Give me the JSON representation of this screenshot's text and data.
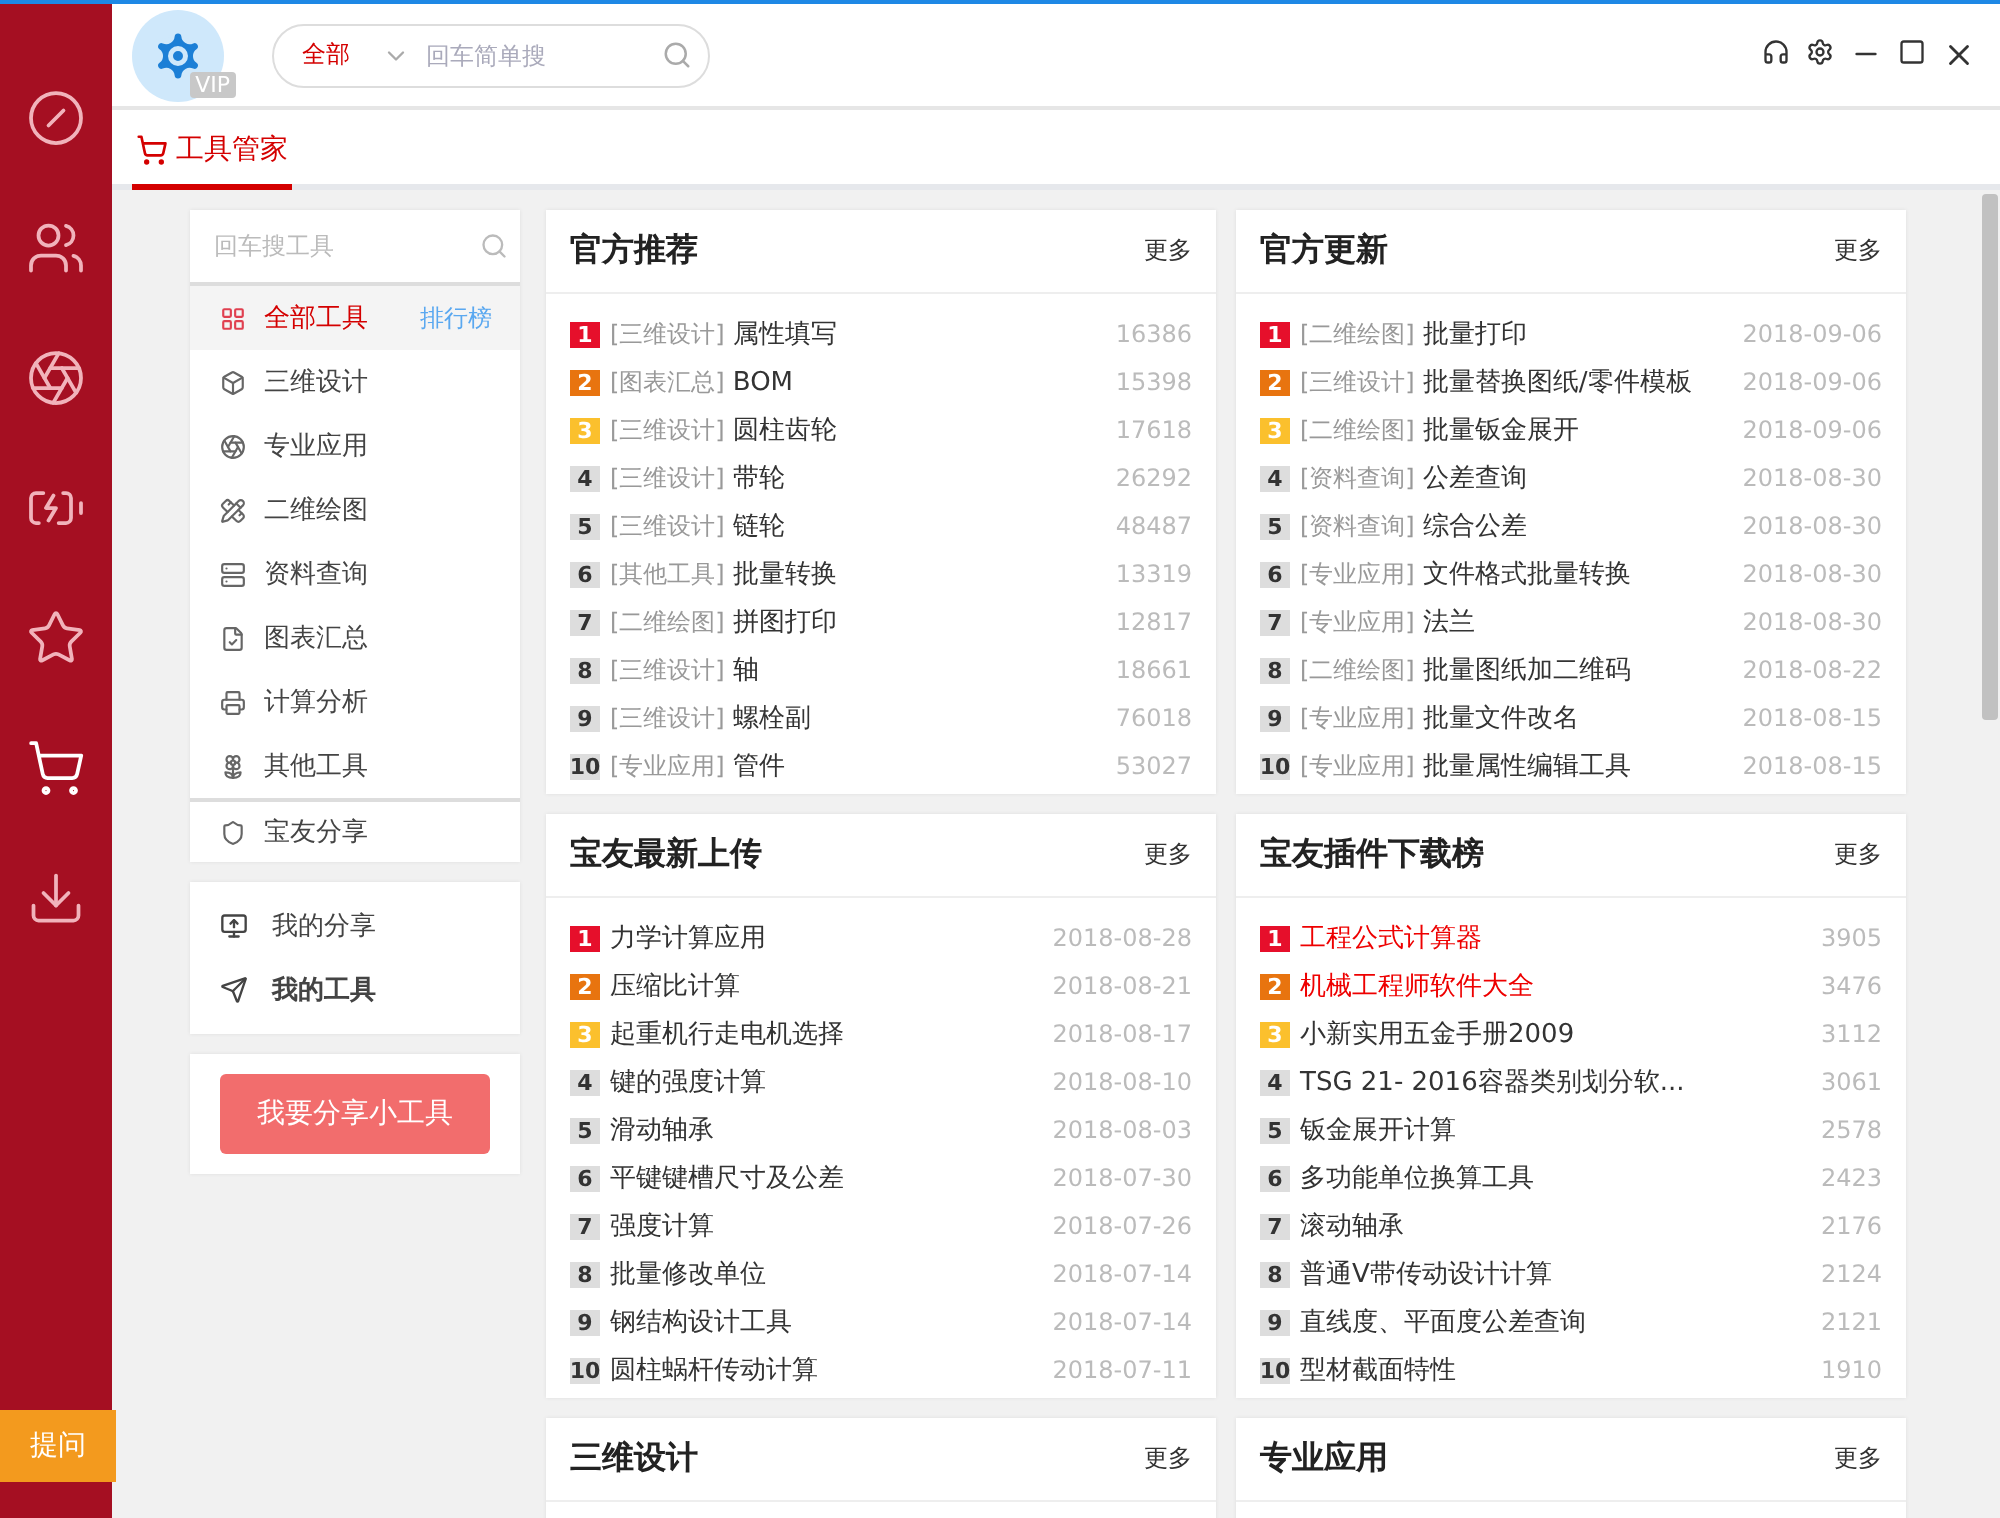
{
  "rail": {
    "items": [
      {
        "selected": false
      },
      {
        "selected": false
      },
      {
        "selected": false
      },
      {
        "selected": false
      },
      {
        "selected": false
      },
      {
        "selected": true
      },
      {
        "selected": false
      }
    ],
    "ask_button": "提问"
  },
  "header": {
    "vip_badge": "VIP",
    "search": {
      "scope": "全部",
      "placeholder": "回车简单搜"
    }
  },
  "tabs": [
    {
      "label": "工具管家",
      "selected": true
    }
  ],
  "sidebar": {
    "search": {
      "placeholder": "回车搜工具"
    },
    "categories": [
      {
        "label": "全部工具",
        "selected": true,
        "extra": "排行榜"
      },
      {
        "label": "三维设计",
        "selected": false
      },
      {
        "label": "专业应用",
        "selected": false
      },
      {
        "label": "二维绘图",
        "selected": false
      },
      {
        "label": "资料查询",
        "selected": false
      },
      {
        "label": "图表汇总",
        "selected": false
      },
      {
        "label": "计算分析",
        "selected": false
      },
      {
        "label": "其他工具",
        "selected": false
      },
      {
        "label": "宝友分享",
        "selected": false
      }
    ],
    "mine": [
      {
        "label": "我的分享",
        "bold": false
      },
      {
        "label": "我的工具",
        "bold": true
      }
    ],
    "share_button": "我要分享小工具"
  },
  "panels": [
    {
      "title": "官方推荐",
      "more": "更多",
      "items": [
        {
          "rank": "1",
          "color": "#e60f2b",
          "tag": "[三维设计]",
          "name": "属性填写",
          "value": "16386",
          "hot": false
        },
        {
          "rank": "2",
          "color": "#e8740f",
          "tag": "[图表汇总]",
          "name": "BOM",
          "value": "15398",
          "hot": false
        },
        {
          "rank": "3",
          "color": "#fbc02d",
          "tag": "[三维设计]",
          "name": "圆柱齿轮",
          "value": "17618",
          "hot": false
        },
        {
          "rank": "4",
          "color": "#dddddd",
          "tag": "[三维设计]",
          "name": "带轮",
          "value": "26292",
          "hot": false
        },
        {
          "rank": "5",
          "color": "#dddddd",
          "tag": "[三维设计]",
          "name": "链轮",
          "value": "48487",
          "hot": false
        },
        {
          "rank": "6",
          "color": "#dddddd",
          "tag": "[其他工具]",
          "name": "批量转换",
          "value": "13319",
          "hot": false
        },
        {
          "rank": "7",
          "color": "#dddddd",
          "tag": "[二维绘图]",
          "name": "拼图打印",
          "value": "12817",
          "hot": false
        },
        {
          "rank": "8",
          "color": "#dddddd",
          "tag": "[三维设计]",
          "name": "轴",
          "value": "18661",
          "hot": false
        },
        {
          "rank": "9",
          "color": "#dddddd",
          "tag": "[三维设计]",
          "name": "螺栓副",
          "value": "76018",
          "hot": false
        },
        {
          "rank": "10",
          "color": "#dddddd",
          "tag": "[专业应用]",
          "name": "管件",
          "value": "53027",
          "hot": false
        }
      ]
    },
    {
      "title": "官方更新",
      "more": "更多",
      "items": [
        {
          "rank": "1",
          "color": "#e60f2b",
          "tag": "[二维绘图]",
          "name": "批量打印",
          "value": "2018-09-06",
          "hot": false
        },
        {
          "rank": "2",
          "color": "#e8740f",
          "tag": "[三维设计]",
          "name": "批量替换图纸/零件模板",
          "value": "2018-09-06",
          "hot": false
        },
        {
          "rank": "3",
          "color": "#fbc02d",
          "tag": "[二维绘图]",
          "name": "批量钣金展开",
          "value": "2018-09-06",
          "hot": false
        },
        {
          "rank": "4",
          "color": "#dddddd",
          "tag": "[资料查询]",
          "name": "公差查询",
          "value": "2018-08-30",
          "hot": false
        },
        {
          "rank": "5",
          "color": "#dddddd",
          "tag": "[资料查询]",
          "name": "综合公差",
          "value": "2018-08-30",
          "hot": false
        },
        {
          "rank": "6",
          "color": "#dddddd",
          "tag": "[专业应用]",
          "name": "文件格式批量转换",
          "value": "2018-08-30",
          "hot": false
        },
        {
          "rank": "7",
          "color": "#dddddd",
          "tag": "[专业应用]",
          "name": "法兰",
          "value": "2018-08-30",
          "hot": false
        },
        {
          "rank": "8",
          "color": "#dddddd",
          "tag": "[二维绘图]",
          "name": "批量图纸加二维码",
          "value": "2018-08-22",
          "hot": false
        },
        {
          "rank": "9",
          "color": "#dddddd",
          "tag": "[专业应用]",
          "name": "批量文件改名",
          "value": "2018-08-15",
          "hot": false
        },
        {
          "rank": "10",
          "color": "#dddddd",
          "tag": "[专业应用]",
          "name": "批量属性编辑工具",
          "value": "2018-08-15",
          "hot": false
        }
      ]
    },
    {
      "title": "宝友最新上传",
      "more": "更多",
      "items": [
        {
          "rank": "1",
          "color": "#e60f2b",
          "name": "力学计算应用",
          "value": "2018-08-28",
          "hot": false
        },
        {
          "rank": "2",
          "color": "#e8740f",
          "name": "压缩比计算",
          "value": "2018-08-21",
          "hot": false
        },
        {
          "rank": "3",
          "color": "#fbc02d",
          "name": "起重机行走电机选择",
          "value": "2018-08-17",
          "hot": false
        },
        {
          "rank": "4",
          "color": "#dddddd",
          "name": "键的强度计算",
          "value": "2018-08-10",
          "hot": false
        },
        {
          "rank": "5",
          "color": "#dddddd",
          "name": "滑动轴承",
          "value": "2018-08-03",
          "hot": false
        },
        {
          "rank": "6",
          "color": "#dddddd",
          "name": "平键键槽尺寸及公差",
          "value": "2018-07-30",
          "hot": false
        },
        {
          "rank": "7",
          "color": "#dddddd",
          "name": "强度计算",
          "value": "2018-07-26",
          "hot": false
        },
        {
          "rank": "8",
          "color": "#dddddd",
          "name": "批量修改单位",
          "value": "2018-07-14",
          "hot": false
        },
        {
          "rank": "9",
          "color": "#dddddd",
          "name": "钢结构设计工具",
          "value": "2018-07-14",
          "hot": false
        },
        {
          "rank": "10",
          "color": "#dddddd",
          "name": "圆柱蜗杆传动计算",
          "value": "2018-07-11",
          "hot": false
        }
      ]
    },
    {
      "title": "宝友插件下载榜",
      "more": "更多",
      "items": [
        {
          "rank": "1",
          "color": "#e60f2b",
          "name": "工程公式计算器",
          "value": "3905",
          "hot": true
        },
        {
          "rank": "2",
          "color": "#e8740f",
          "name": "机械工程师软件大全",
          "value": "3476",
          "hot": true
        },
        {
          "rank": "3",
          "color": "#fbc02d",
          "name": "小新实用五金手册2009",
          "value": "3112",
          "hot": false
        },
        {
          "rank": "4",
          "color": "#dddddd",
          "name": "TSG 21- 2016容器类别划分软...",
          "value": "3061",
          "hot": false
        },
        {
          "rank": "5",
          "color": "#dddddd",
          "name": "钣金展开计算",
          "value": "2578",
          "hot": false
        },
        {
          "rank": "6",
          "color": "#dddddd",
          "name": "多功能单位换算工具",
          "value": "2423",
          "hot": false
        },
        {
          "rank": "7",
          "color": "#dddddd",
          "name": "滚动轴承",
          "value": "2176",
          "hot": false
        },
        {
          "rank": "8",
          "color": "#dddddd",
          "name": "普通V带传动设计计算",
          "value": "2124",
          "hot": false
        },
        {
          "rank": "9",
          "color": "#dddddd",
          "name": "直线度、平面度公差查询",
          "value": "2121",
          "hot": false
        },
        {
          "rank": "10",
          "color": "#dddddd",
          "name": "型材截面特性",
          "value": "1910",
          "hot": false
        }
      ]
    },
    {
      "title": "三维设计",
      "more": "更多"
    },
    {
      "title": "专业应用",
      "more": "更多"
    }
  ]
}
